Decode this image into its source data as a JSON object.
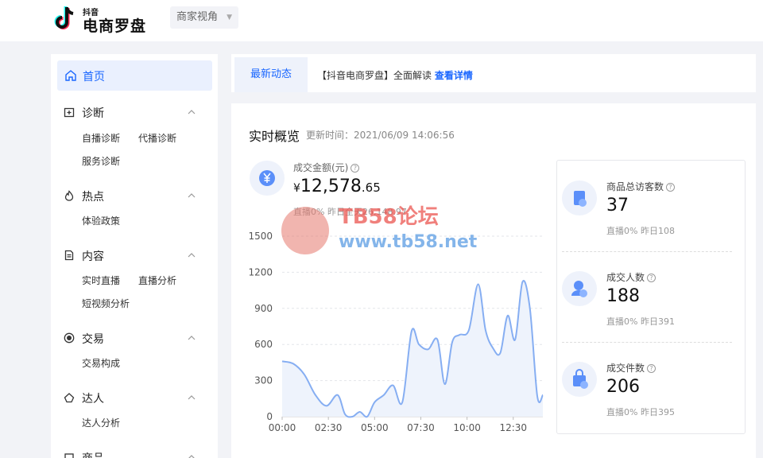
{
  "header": {
    "logo_small": "抖音",
    "logo_title": "电商罗盘",
    "view_select": "商家视角"
  },
  "sidebar": {
    "home": "首页",
    "groups": [
      {
        "label": "诊断",
        "icon": "diagnosis-icon",
        "items": [
          "自播诊断",
          "代播诊断",
          "服务诊断"
        ]
      },
      {
        "label": "热点",
        "icon": "flame-icon",
        "items": [
          "体验政策"
        ]
      },
      {
        "label": "内容",
        "icon": "document-icon",
        "items": [
          "实时直播",
          "直播分析",
          "短视频分析"
        ]
      },
      {
        "label": "交易",
        "icon": "yuan-coin-icon",
        "items": [
          "交易构成"
        ]
      },
      {
        "label": "达人",
        "icon": "influencer-icon",
        "items": [
          "达人分析"
        ]
      },
      {
        "label": "商品",
        "icon": "goods-icon",
        "items": []
      }
    ]
  },
  "notice": {
    "tab": "最新动态",
    "text": "【抖音电商罗盘】全面解读",
    "link": "查看详情"
  },
  "overview": {
    "title": "实时概览",
    "updated": "更新时间：2021/06/09 14:06:56",
    "amount_label": "成交金额(元)",
    "amount_currency": "¥",
    "amount_int": "12,578",
    "amount_dec": ".65",
    "amount_sub": "直播0%   昨日全天26,148.97"
  },
  "stats": [
    {
      "label": "商品总访客数",
      "value": "37",
      "sub": "直播0%   昨日108",
      "icon": "visitor-icon"
    },
    {
      "label": "成交人数",
      "value": "188",
      "sub": "直播0%   昨日391",
      "icon": "buyer-icon"
    },
    {
      "label": "成交件数",
      "value": "206",
      "sub": "直播0%   昨日395",
      "icon": "shopping-bag-icon"
    }
  ],
  "watermark": {
    "title": "TB58论坛",
    "url": "www.tb58.net"
  },
  "chart_data": {
    "type": "area",
    "x_ticks": [
      "00:00",
      "02:30",
      "05:00",
      "07:30",
      "10:00",
      "12:30"
    ],
    "y_ticks": [
      0,
      300,
      600,
      900,
      1200,
      1500
    ],
    "ylim": [
      0,
      1500
    ],
    "xlim_hours": [
      0,
      14.1
    ],
    "series": [
      {
        "x_hours": [
          0,
          0.6,
          1.2,
          1.8,
          2.4,
          3.0,
          3.4,
          3.8,
          4.2,
          4.6,
          5.0,
          5.5,
          6.0,
          6.5,
          7.0,
          7.4,
          7.9,
          8.4,
          8.8,
          9.2,
          9.6,
          10.1,
          10.6,
          11.0,
          11.4,
          11.8,
          12.2,
          12.6,
          13.0,
          13.4,
          13.8,
          14.1
        ],
        "values": [
          460,
          440,
          350,
          180,
          90,
          180,
          20,
          0,
          40,
          0,
          120,
          180,
          260,
          120,
          710,
          600,
          560,
          640,
          270,
          620,
          680,
          720,
          1100,
          720,
          570,
          530,
          840,
          640,
          1120,
          900,
          170,
          180
        ]
      }
    ],
    "colors": {
      "line": "#86aef2",
      "fill": "#eef3fc"
    },
    "grid": "horizontal-dashed"
  }
}
